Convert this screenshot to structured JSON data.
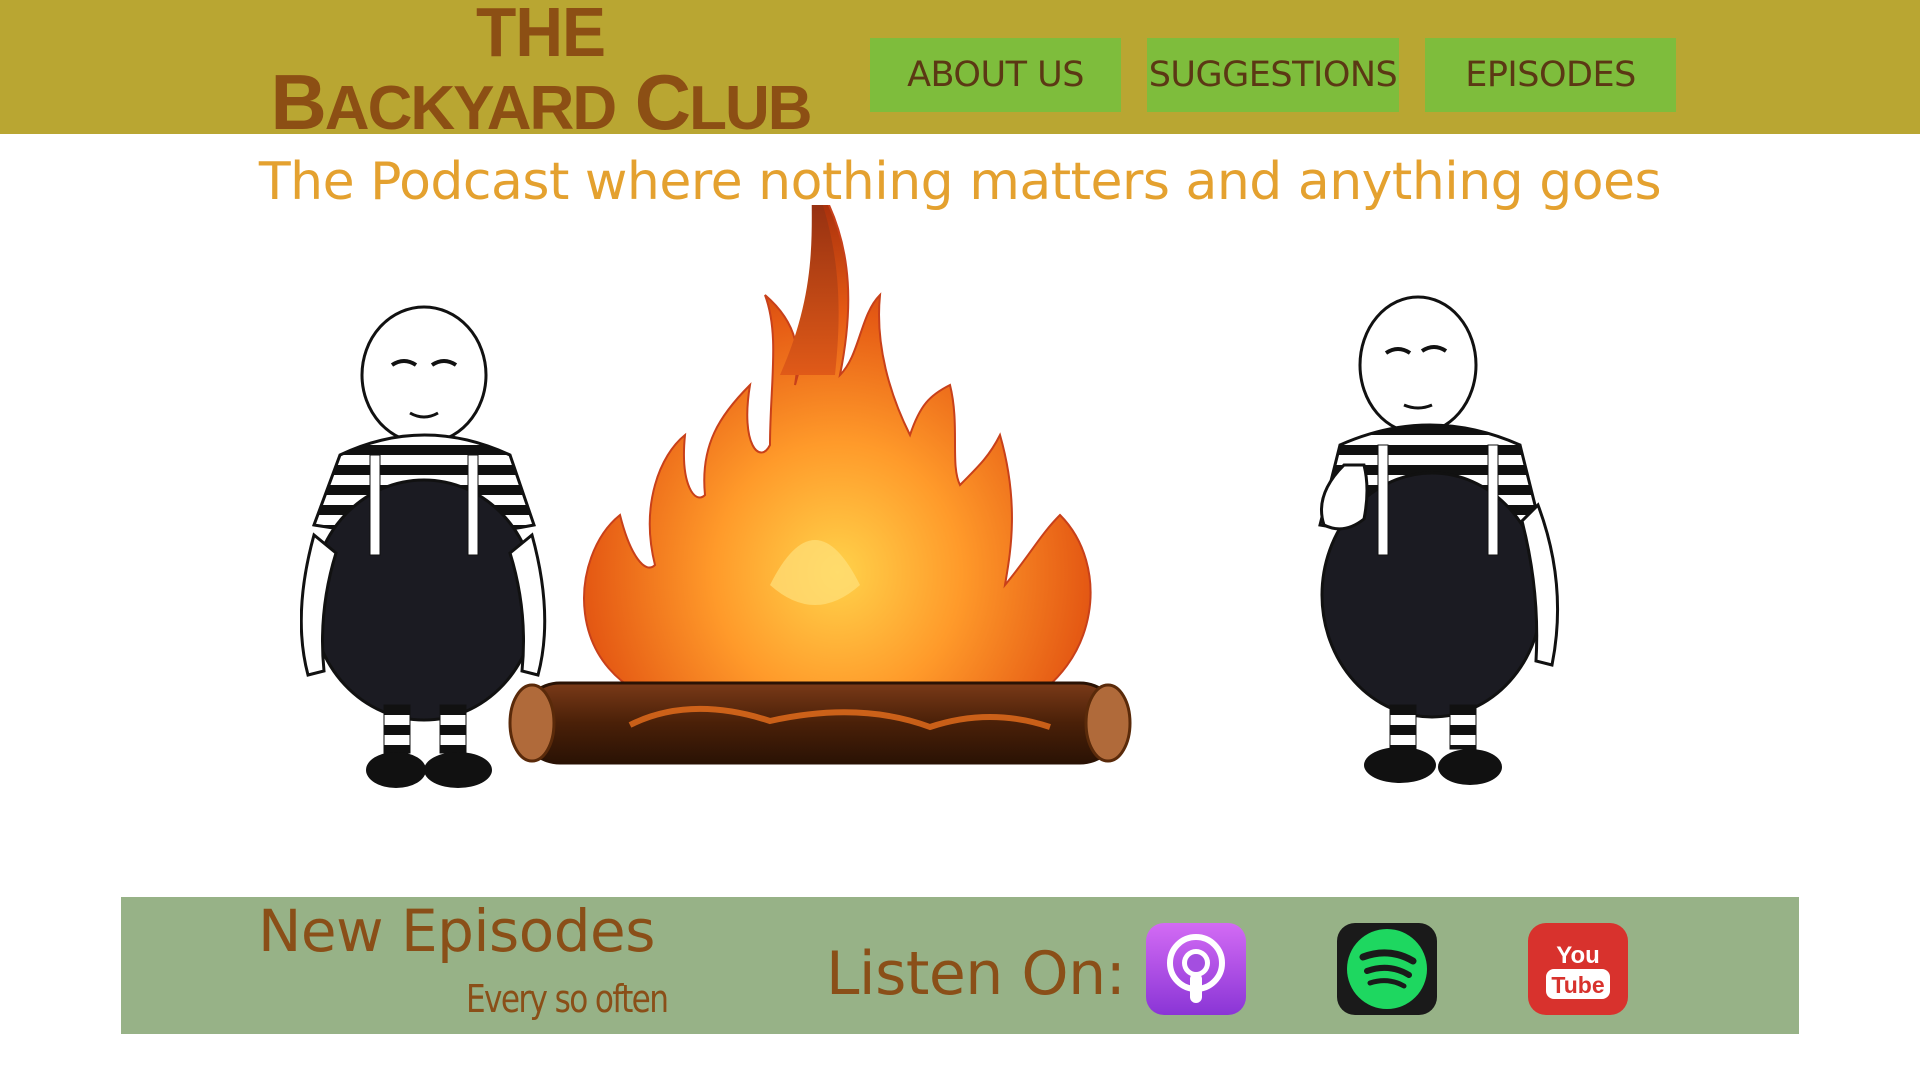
{
  "logo": {
    "line1": "THE",
    "line2_big_b": "B",
    "line2_rest": "ACKYARD",
    "line2_big_c": "C",
    "line2_end": "LUB"
  },
  "nav": {
    "about": "ABOUT US",
    "suggestions": "SUGGESTIONS",
    "episodes": "EPISODES"
  },
  "tagline": "The Podcast where nothing matters and anything goes",
  "bar": {
    "new_episodes": "New Episodes",
    "every_so_often": "Every so often",
    "listen_on": "Listen On:",
    "platforms": [
      "apple-podcasts-icon",
      "spotify-icon",
      "youtube-icon"
    ],
    "youtube_text1": "You",
    "youtube_text2": "Tube"
  },
  "colors": {
    "header": "#b9a632",
    "nav_button": "#7ebd3c",
    "logo_text": "#8c4f14",
    "tagline": "#e4a12f",
    "bar": "#97b287"
  }
}
